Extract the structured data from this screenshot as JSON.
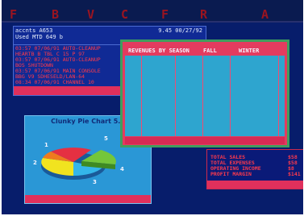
{
  "menubar": {
    "keys": [
      "F",
      "B",
      "V",
      "C",
      "F",
      "R",
      "A"
    ]
  },
  "status_window": {
    "account": "accnts A653",
    "used": "Used MTD  649 b",
    "time": "9.45 00/27/92",
    "log_lines": [
      "03:57 07/06/91 AUTO-CLEANUP",
      "HEARTB B  TBL C  15 P  97",
      "03:57 07/06/91 AUTO-CLEANUP",
      "BOS SHUTDOWN",
      "03:57 07/06/91 MAIN CONSOLE",
      "BBG V9 SDHESELD/LAN-64",
      "08:34 07/06/91 CHANNEL 10"
    ]
  },
  "revenue_window": {
    "header_label": "REVENUES BY SEASON",
    "columns": [
      "FALL",
      "WINTER"
    ]
  },
  "pie_window": {
    "title": "Clunky Pie Chart 5.2",
    "slice_labels": [
      "1",
      "2",
      "3",
      "4",
      "5"
    ],
    "colors": {
      "slice1": "#ef7a1e",
      "slice2": "#f1e31f",
      "slice3": "#34b6ea",
      "slice4": "#74c63a",
      "slice5": "#e53042"
    }
  },
  "totals_window": {
    "rows": [
      {
        "label": "TOTAL SALES",
        "value": "$58"
      },
      {
        "label": "TOTAL EXPENSES",
        "value": "$58"
      },
      {
        "label": "OPERATING INCOME",
        "value": "$8"
      },
      {
        "label": "PROFIT MARGIN",
        "value": "$141"
      }
    ]
  },
  "palette": {
    "desktop": "#071d6b",
    "accent_red": "#e0305c",
    "border_green": "#3f9e5e",
    "grid_cyan": "#2ea5cf"
  }
}
